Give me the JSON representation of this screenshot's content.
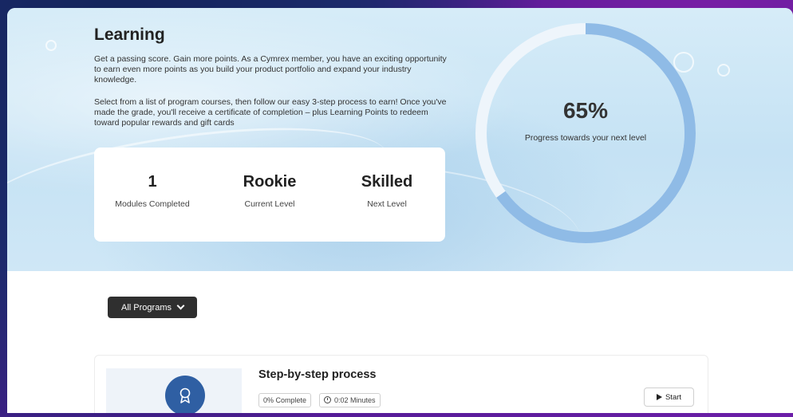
{
  "colors": {
    "accent": "#8fbbe6",
    "track": "#eef5fb",
    "dark_button": "#2f2f2f",
    "badge": "#2f5fa3"
  },
  "hero": {
    "title": "Learning",
    "paragraph1": "Get a passing score. Gain more points. As a Cymrex member, you have an exciting opportunity to earn even more points as you build your product portfolio and expand your industry knowledge.",
    "paragraph2": "Select from a list of program courses, then follow our easy 3-step process to earn! Once you've made the grade, you'll receive a certificate of completion – plus Learning Points to redeem toward popular rewards and gift cards"
  },
  "stats": [
    {
      "value": "1",
      "label": "Modules Completed"
    },
    {
      "value": "Rookie",
      "label": "Current Level"
    },
    {
      "value": "Skilled",
      "label": "Next Level"
    }
  ],
  "progress": {
    "percent_text": "65%",
    "fraction": 0.65,
    "label": "Progress towards your next level"
  },
  "filter": {
    "label": "All Programs",
    "icon": "chevron-down-icon"
  },
  "course": {
    "title": "Step-by-step process",
    "complete_tag": "0% Complete",
    "duration_tag": "0:02 Minutes",
    "start_label": "Start",
    "badge_icon": "award-icon",
    "clock_icon": "clock-icon",
    "play_icon": "play-icon"
  }
}
